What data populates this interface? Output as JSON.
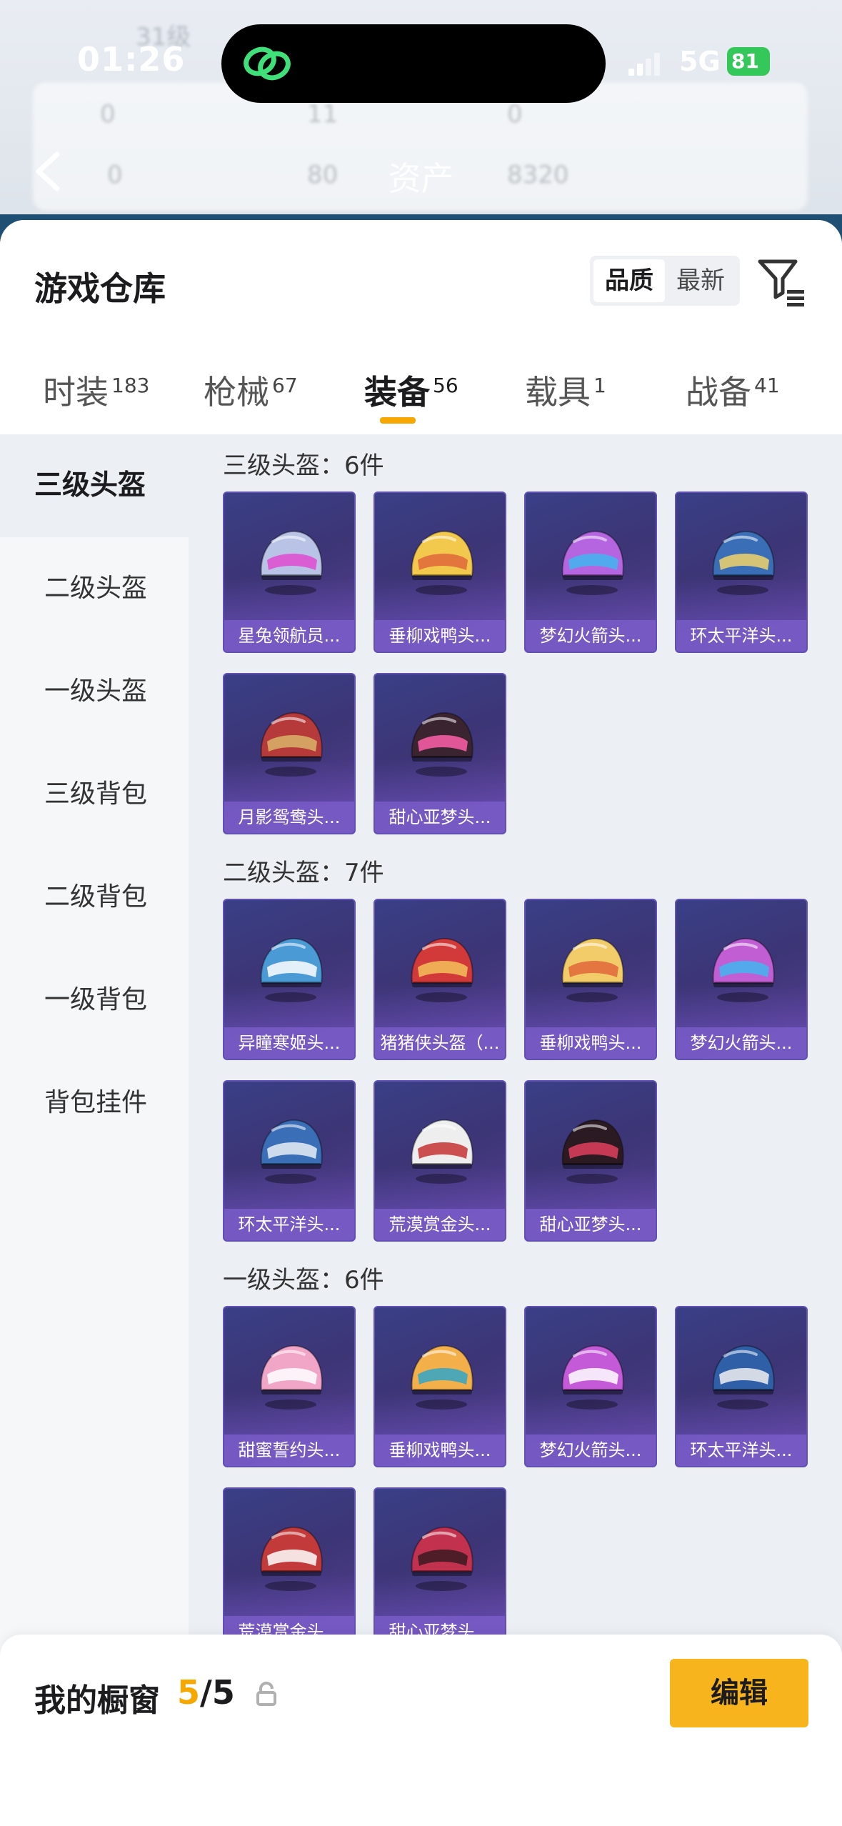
{
  "status_bar": {
    "time": "01:26",
    "network": "5G",
    "battery": "81"
  },
  "background_header": {
    "title": "资产",
    "ghost_texts": [
      "31级",
      "0",
      "11",
      "0",
      "0",
      "80",
      "8320"
    ]
  },
  "sheet": {
    "title": "游戏仓库",
    "sort": {
      "options": [
        "品质",
        "最新"
      ],
      "selected": "品质"
    },
    "tabs": [
      {
        "label": "时装",
        "count": "183"
      },
      {
        "label": "枪械",
        "count": "67"
      },
      {
        "label": "装备",
        "count": "56",
        "active": true
      },
      {
        "label": "载具",
        "count": "1"
      },
      {
        "label": "战备",
        "count": "41"
      }
    ]
  },
  "categories": [
    "三级头盔",
    "二级头盔",
    "一级头盔",
    "三级背包",
    "二级背包",
    "一级背包",
    "背包挂件"
  ],
  "active_category": "三级头盔",
  "sections": [
    {
      "title": "三级头盔：6件",
      "items": [
        {
          "name": "星兔领航员...",
          "color": "#b9c3e6",
          "accent": "#e04bd0"
        },
        {
          "name": "垂柳戏鸭头...",
          "color": "#f2c94c",
          "accent": "#e0673a"
        },
        {
          "name": "梦幻火箭头...",
          "color": "#b565e0",
          "accent": "#3fb6f0"
        },
        {
          "name": "环太平洋头...",
          "color": "#3a6fb8",
          "accent": "#f1d36a"
        },
        {
          "name": "月影鸳鸯头...",
          "color": "#b73a3a",
          "accent": "#d9b46a"
        },
        {
          "name": "甜心亚梦头...",
          "color": "#3a2430",
          "accent": "#ff5fa8"
        }
      ]
    },
    {
      "title": "二级头盔：7件",
      "items": [
        {
          "name": "异瞳寒姬头...",
          "color": "#4a9ad6",
          "accent": "#ffffff"
        },
        {
          "name": "猪猪侠头盔（...",
          "color": "#d23a3a",
          "accent": "#f4c15a"
        },
        {
          "name": "垂柳戏鸭头...",
          "color": "#f3cc6a",
          "accent": "#e0673a"
        },
        {
          "name": "梦幻火箭头...",
          "color": "#c25ed4",
          "accent": "#3fb6f0"
        },
        {
          "name": "环太平洋头...",
          "color": "#3a6fb8",
          "accent": "#e9eef5"
        },
        {
          "name": "荒漠赏金头...",
          "color": "#eeeeee",
          "accent": "#c43333"
        },
        {
          "name": "甜心亚梦头...",
          "color": "#2b1a22",
          "accent": "#e0405e"
        }
      ]
    },
    {
      "title": "一级头盔：6件",
      "items": [
        {
          "name": "甜蜜誓约头...",
          "color": "#f1a6c8",
          "accent": "#ffffff"
        },
        {
          "name": "垂柳戏鸭头...",
          "color": "#f3b04a",
          "accent": "#2fa6c8"
        },
        {
          "name": "梦幻火箭头...",
          "color": "#c45ad8",
          "accent": "#ffffff"
        },
        {
          "name": "环太平洋头...",
          "color": "#2f5fa6",
          "accent": "#f0f0f0"
        },
        {
          "name": "荒漠赏金头...",
          "color": "#c33a3a",
          "accent": "#ffffff"
        },
        {
          "name": "甜心亚梦头...",
          "color": "#c2324e",
          "accent": "#3a1a22"
        }
      ]
    }
  ],
  "showcase": {
    "label": "我的橱窗",
    "current": "5",
    "total": "/5",
    "edit_label": "编辑"
  },
  "colors": {
    "accent": "#f6a800",
    "card_label": "#7c5ecc",
    "card_bg": "#3c3576"
  }
}
